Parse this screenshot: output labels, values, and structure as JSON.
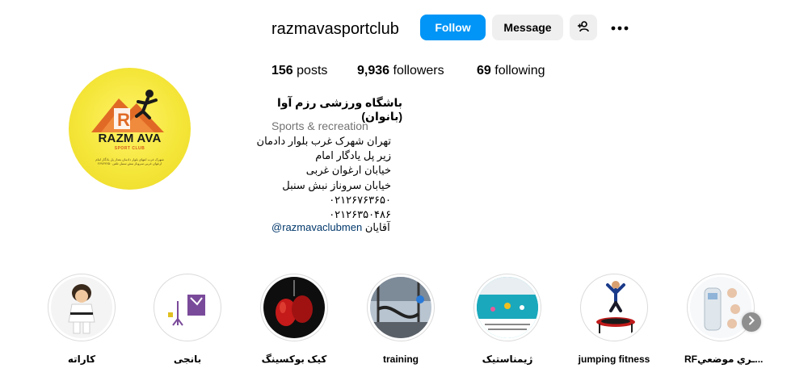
{
  "profile": {
    "username": "razmavasportclub",
    "full_name": "باشگاه ورزشی رزم آوا (بانوان)",
    "category": "Sports & recreation",
    "address_lines": [
      "تهران شهرک غرب بلوار دادمان",
      "زیر پل یادگار امام",
      "خیابان ارغوان غربی",
      "خیابان سروناز نبش سنبل",
      "۰۲۱۲۶۷۶۳۶۵۰",
      "۰۲۱۲۶۳۵۰۴۸۶"
    ],
    "mention_prefix": "آقایان ",
    "mention": "@razmavaclubmen",
    "avatar_logo": {
      "main": "RAZM AVA",
      "sub": "SPORT CLUB",
      "address": "شهرک غرب انتهای بلوار دادمان بعداز پل یادگار امام ارغوان غربی سروناز نبش سنبل تلفن ۲۶۷۶۳۶۵۰"
    }
  },
  "buttons": {
    "follow": "Follow",
    "message": "Message",
    "suggest_icon": "add-person-icon",
    "more_icon": "more-options-icon"
  },
  "stats": {
    "posts_count": "156",
    "posts_label": " posts",
    "followers_count": "9,936",
    "followers_label": " followers",
    "following_count": "69",
    "following_label": " following"
  },
  "highlights": [
    {
      "label": "کاراته"
    },
    {
      "label": "بانجی"
    },
    {
      "label": "کیک بوکسینگ"
    },
    {
      "label": "training"
    },
    {
      "label": "ژیمناستیک"
    },
    {
      "label": "jumping fitness"
    },
    {
      "label": "RFـري موضعي..."
    }
  ],
  "colors": {
    "primary_button": "#0095f6",
    "secondary_button": "#efefef",
    "link": "#00376b",
    "muted_text": "#737373",
    "avatar_bg": "#f5e63a",
    "logo_orange": "#e06a25"
  }
}
